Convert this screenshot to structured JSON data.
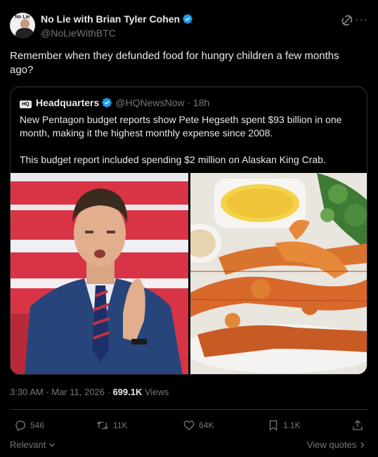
{
  "post": {
    "author_name": "No Lie with Brian Tyler Cohen",
    "author_handle": "@NoLieWithBTC",
    "avatar_text": "No Lie",
    "text": "Remember when they defunded food for hungry children a few months ago?",
    "timestamp": "3:30 AM · Mar 11, 2026 · ",
    "views_count": "699.1K",
    "views_label": " Views"
  },
  "quote": {
    "logo_text": "HQ",
    "author_name": "Headquarters",
    "author_handle": "@HQNewsNow · 18h",
    "paragraph1": "New Pentagon budget reports show Pete Hegseth spent $93 billion in one month, making it the highest monthly expense since 2008.",
    "paragraph2": "This budget report included spending $2 million on Alaskan King Crab."
  },
  "actions": {
    "replies": "546",
    "reposts": "11K",
    "likes": "64K",
    "bookmarks": "1.1K"
  },
  "footer": {
    "sort_label": "Relevant",
    "view_quotes": "View quotes"
  },
  "colors": {
    "background": "#000000",
    "text": "#e7e9ea",
    "muted": "#71767b",
    "border": "#2f3336",
    "verified": "#1d9bf0"
  },
  "icons": [
    "verified-badge-icon",
    "grok-icon",
    "more-icon",
    "reply-icon",
    "repost-icon",
    "like-icon",
    "bookmark-icon",
    "share-icon",
    "chevron-down-icon",
    "chevron-right-icon"
  ]
}
